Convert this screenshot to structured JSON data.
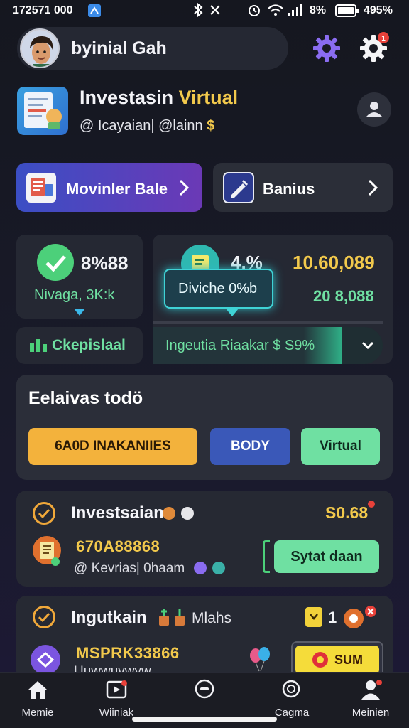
{
  "status_bar": {
    "time": "172571 000",
    "signal_text": "8%",
    "battery": "495%"
  },
  "header": {
    "user_name": "byinial Gah"
  },
  "app": {
    "title_main": "Investasin",
    "title_accent": "Virtual",
    "subtitle": "@ Icayaian| @lainn"
  },
  "nav": {
    "left_label": "Movinler Bale",
    "right_label": "Banius"
  },
  "stats": {
    "left_value": "8%88",
    "left_sub": "Nivaga, 3K:k",
    "left_footer": "Ckepislaal",
    "right_percent": "4.%",
    "right_value": "10.60,089",
    "tooltip": "Diviche 0%b",
    "right_sub_value": "20 8,088",
    "progress_label": "Ingeutia Riaakar $ S9%",
    "progress_fraction": 0.82
  },
  "todo": {
    "title": "Eelaivas todö",
    "buttons": [
      "6A0D INAKANIIES",
      "BODY",
      "Virtual"
    ]
  },
  "investments": [
    {
      "title": "Investsaian",
      "amount": "S0.68",
      "code": "670A88868",
      "sub": "@ Kevrias| 0haam",
      "action": "Sytat daan"
    },
    {
      "title": "Ingutkain",
      "title_extra": "Mlahs",
      "count": "1",
      "code": "MSPRK33866",
      "sub": "Uuwwuvwyw",
      "action": "SUM"
    }
  ],
  "bottom_nav": [
    "Memie",
    "Wiiniak",
    "",
    "Cagma",
    "Meinien"
  ],
  "colors": {
    "accent_yellow": "#f2c94c",
    "accent_green": "#6fe0a2",
    "accent_blue": "#3a58b8",
    "accent_orange": "#f3b23c",
    "teal": "#2fb8b0"
  }
}
